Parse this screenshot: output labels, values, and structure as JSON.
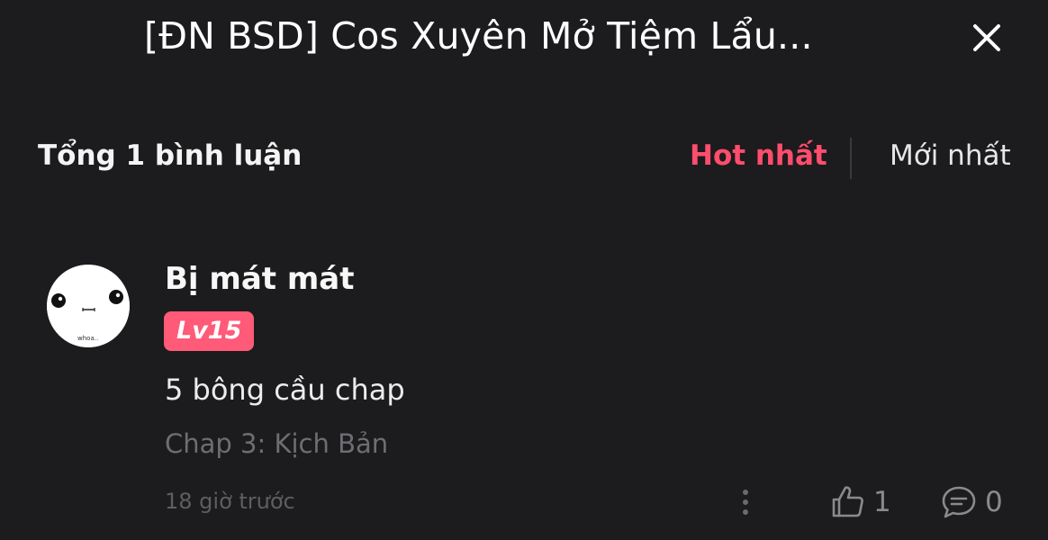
{
  "header": {
    "title": "[ĐN BSD] Cos Xuyên Mở Tiệm Lẩu..."
  },
  "comments_header": {
    "total_label": "Tổng 1 bình luận",
    "sort_hot_label": "Hot nhất",
    "sort_new_label": "Mới nhất"
  },
  "comment": {
    "username": "Bị mát mát",
    "level_badge": "Lv15",
    "text": "5 bông cầu chap",
    "chapter": "Chap 3: Kịch Bản",
    "timestamp": "18 giờ trước",
    "like_count": "1",
    "reply_count": "0",
    "avatar_caption": "whoa.."
  },
  "colors": {
    "background": "#1c1b1d",
    "accent": "#ff4d6d",
    "badge": "#ff5a78",
    "muted_text": "#6e6d71"
  }
}
